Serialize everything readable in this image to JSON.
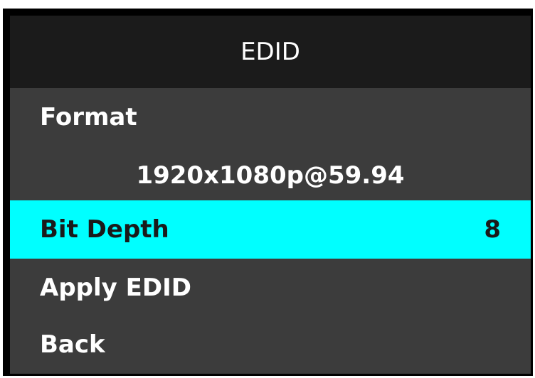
{
  "title": "EDID",
  "menu": {
    "format_label": "Format",
    "format_value": "1920x1080p@59.94",
    "bit_depth_label": "Bit Depth",
    "bit_depth_value": "8",
    "apply_label": "Apply EDID",
    "back_label": "Back"
  },
  "colors": {
    "highlight": "#00ffff",
    "menu_background": "#3c3c3c",
    "title_background": "#1b1b1b",
    "text": "#ffffff"
  }
}
